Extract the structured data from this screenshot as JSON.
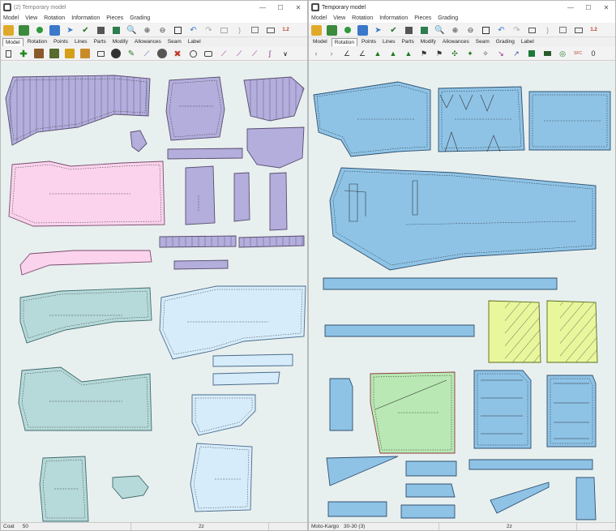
{
  "left_window": {
    "title": "(2) Temporary model",
    "menu": [
      "Model",
      "View",
      "Rotation",
      "Information",
      "Pieces",
      "Grading"
    ],
    "tabs": [
      "Model",
      "Rotation",
      "Points",
      "Lines",
      "Parts",
      "Modify",
      "Allowances",
      "Seam",
      "Label"
    ],
    "active_tab": "Model",
    "status": {
      "label": "Coat",
      "value": "50",
      "right": "2z"
    },
    "colors": {
      "purple": "#b3aedc",
      "pink": "#fbd3ec",
      "teal": "#b6d9d9",
      "lightblue": "#d6ecfb"
    }
  },
  "right_window": {
    "title": "Temporary model",
    "menu": [
      "Model",
      "View",
      "Rotation",
      "Information",
      "Pieces",
      "Grading"
    ],
    "tabs": [
      "Model",
      "Rotation",
      "Points",
      "Lines",
      "Parts",
      "Modify",
      "Allowances",
      "Seam",
      "Grading",
      "Label"
    ],
    "active_tab": "Rotation",
    "status": {
      "label": "Moto-Kargo",
      "value": "30-30 (3)",
      "right": "2z"
    },
    "colors": {
      "blue": "#8ec3e6",
      "yellow": "#e8f79b",
      "green": "#b9e8b4"
    }
  },
  "window_buttons": {
    "minimize": "—",
    "maximize": "☐",
    "close": "✕"
  },
  "toolbar_label": "1.2"
}
